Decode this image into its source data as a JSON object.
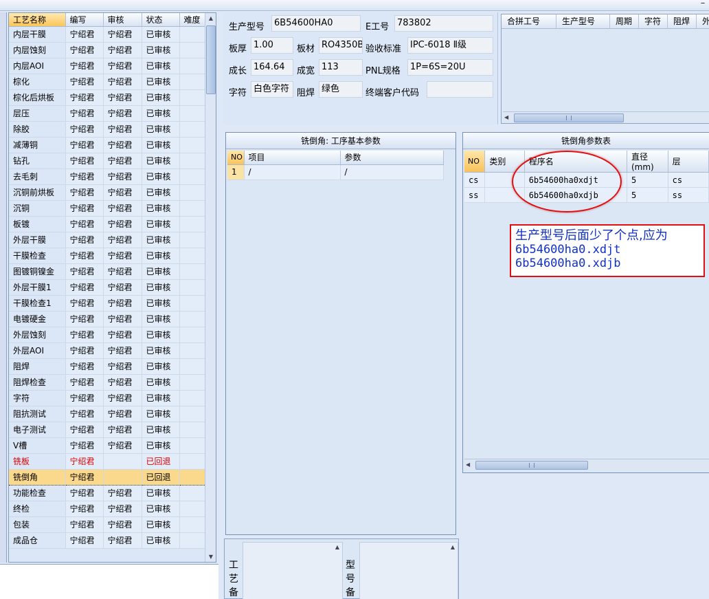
{
  "window": {
    "minimize_glyph": "–"
  },
  "process_grid": {
    "columns": [
      "工艺名称",
      "编写",
      "审核",
      "状态",
      "难度"
    ],
    "rows": [
      {
        "name": "内层干膜",
        "writer": "宁绍君",
        "reviewer": "宁绍君",
        "status": "已审核",
        "style": ""
      },
      {
        "name": "内层蚀刻",
        "writer": "宁绍君",
        "reviewer": "宁绍君",
        "status": "已审核",
        "style": ""
      },
      {
        "name": "内层AOI",
        "writer": "宁绍君",
        "reviewer": "宁绍君",
        "status": "已审核",
        "style": ""
      },
      {
        "name": "棕化",
        "writer": "宁绍君",
        "reviewer": "宁绍君",
        "status": "已审核",
        "style": ""
      },
      {
        "name": "棕化后烘板",
        "writer": "宁绍君",
        "reviewer": "宁绍君",
        "status": "已审核",
        "style": ""
      },
      {
        "name": "层压",
        "writer": "宁绍君",
        "reviewer": "宁绍君",
        "status": "已审核",
        "style": ""
      },
      {
        "name": "除胶",
        "writer": "宁绍君",
        "reviewer": "宁绍君",
        "status": "已审核",
        "style": ""
      },
      {
        "name": "减薄铜",
        "writer": "宁绍君",
        "reviewer": "宁绍君",
        "status": "已审核",
        "style": ""
      },
      {
        "name": "钻孔",
        "writer": "宁绍君",
        "reviewer": "宁绍君",
        "status": "已审核",
        "style": ""
      },
      {
        "name": "去毛刺",
        "writer": "宁绍君",
        "reviewer": "宁绍君",
        "status": "已审核",
        "style": ""
      },
      {
        "name": "沉铜前烘板",
        "writer": "宁绍君",
        "reviewer": "宁绍君",
        "status": "已审核",
        "style": ""
      },
      {
        "name": "沉铜",
        "writer": "宁绍君",
        "reviewer": "宁绍君",
        "status": "已审核",
        "style": ""
      },
      {
        "name": "板镀",
        "writer": "宁绍君",
        "reviewer": "宁绍君",
        "status": "已审核",
        "style": ""
      },
      {
        "name": "外层干膜",
        "writer": "宁绍君",
        "reviewer": "宁绍君",
        "status": "已审核",
        "style": ""
      },
      {
        "name": "干膜检查",
        "writer": "宁绍君",
        "reviewer": "宁绍君",
        "status": "已审核",
        "style": ""
      },
      {
        "name": "图镀铜镍金",
        "writer": "宁绍君",
        "reviewer": "宁绍君",
        "status": "已审核",
        "style": ""
      },
      {
        "name": "外层干膜1",
        "writer": "宁绍君",
        "reviewer": "宁绍君",
        "status": "已审核",
        "style": ""
      },
      {
        "name": "干膜检查1",
        "writer": "宁绍君",
        "reviewer": "宁绍君",
        "status": "已审核",
        "style": ""
      },
      {
        "name": "电镀硬金",
        "writer": "宁绍君",
        "reviewer": "宁绍君",
        "status": "已审核",
        "style": ""
      },
      {
        "name": "外层蚀刻",
        "writer": "宁绍君",
        "reviewer": "宁绍君",
        "status": "已审核",
        "style": ""
      },
      {
        "name": "外层AOI",
        "writer": "宁绍君",
        "reviewer": "宁绍君",
        "status": "已审核",
        "style": ""
      },
      {
        "name": "阻焊",
        "writer": "宁绍君",
        "reviewer": "宁绍君",
        "status": "已审核",
        "style": ""
      },
      {
        "name": "阻焊检查",
        "writer": "宁绍君",
        "reviewer": "宁绍君",
        "status": "已审核",
        "style": ""
      },
      {
        "name": "字符",
        "writer": "宁绍君",
        "reviewer": "宁绍君",
        "status": "已审核",
        "style": ""
      },
      {
        "name": "阻抗测试",
        "writer": "宁绍君",
        "reviewer": "宁绍君",
        "status": "已审核",
        "style": ""
      },
      {
        "name": "电子测试",
        "writer": "宁绍君",
        "reviewer": "宁绍君",
        "status": "已审核",
        "style": ""
      },
      {
        "name": "V槽",
        "writer": "宁绍君",
        "reviewer": "宁绍君",
        "status": "已审核",
        "style": ""
      },
      {
        "name": "铣板",
        "writer": "宁绍君",
        "reviewer": "",
        "status": "已回退",
        "style": "red"
      },
      {
        "name": "铣倒角",
        "writer": "宁绍君",
        "reviewer": "",
        "status": "已回退",
        "style": "sel"
      },
      {
        "name": "功能检查",
        "writer": "宁绍君",
        "reviewer": "宁绍君",
        "status": "已审核",
        "style": ""
      },
      {
        "name": "终检",
        "writer": "宁绍君",
        "reviewer": "宁绍君",
        "status": "已审核",
        "style": ""
      },
      {
        "name": "包装",
        "writer": "宁绍君",
        "reviewer": "宁绍君",
        "status": "已审核",
        "style": ""
      },
      {
        "name": "成品仓",
        "writer": "宁绍君",
        "reviewer": "宁绍君",
        "status": "已审核",
        "style": ""
      }
    ]
  },
  "info": {
    "model_label": "生产型号",
    "model_value": "6B54600HA0",
    "eno_label": "E工号",
    "eno_value": "783802",
    "thickness_label": "板厚",
    "thickness_value": "1.00",
    "material_label": "板材",
    "material_value": "RO4350B",
    "standard_label": "验收标准",
    "standard_value": "IPC-6018 Ⅱ级",
    "length_label": "成长",
    "length_value": "164.64",
    "width_label": "成宽",
    "width_value": "113",
    "pnl_label": "PNL规格",
    "pnl_value": "1P=6S=20U",
    "char_label": "字符",
    "char_value": "白色字符",
    "mask_label": "阻焊",
    "mask_value": "绿色",
    "customer_label": "终端客户代码",
    "customer_value": ""
  },
  "merge_grid": {
    "columns": [
      "合拼工号",
      "生产型号",
      "周期",
      "字符",
      "阻焊",
      "外层"
    ]
  },
  "base_params": {
    "title": "铣倒角: 工序基本参数",
    "columns": [
      "NO",
      "项目",
      "参数"
    ],
    "rows": [
      {
        "no": "1",
        "item": "/",
        "param": "/"
      }
    ]
  },
  "mill_params": {
    "title": "铣倒角参数表",
    "columns": [
      "NO",
      "类别",
      "程序名",
      "直径(mm)",
      "层"
    ],
    "rows": [
      {
        "no": "cs",
        "category": "",
        "program": "6b54600ha0xdjt",
        "diameter": "5",
        "layer": "cs"
      },
      {
        "no": "ss",
        "category": "",
        "program": "6b54600ha0xdjb",
        "diameter": "5",
        "layer": "ss"
      }
    ]
  },
  "annotation": {
    "line1": "生产型号后面少了个点,应为",
    "line2": "6b54600ha0.xdjt",
    "line3": "6b54600ha0.xdjb",
    "color": "#e01010",
    "text_color": "#1030c8"
  },
  "remarks": {
    "left_label": [
      "工",
      "艺",
      "备"
    ],
    "right_label": [
      "型",
      "号",
      "备"
    ]
  }
}
